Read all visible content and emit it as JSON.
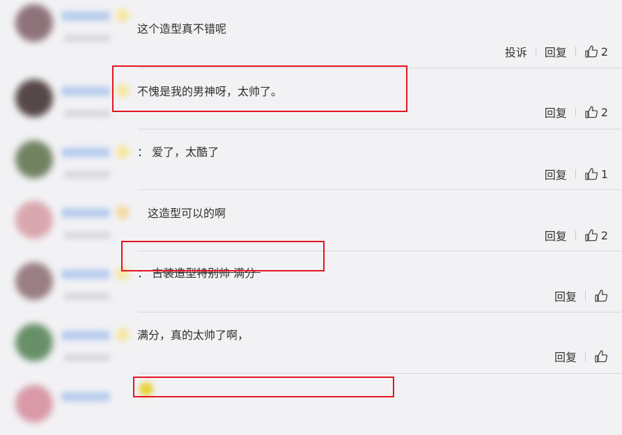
{
  "comments": [
    {
      "text": "这个造型真不错呢",
      "report_label": "投诉",
      "reply_label": "回复",
      "likes": "2",
      "avatar_color": "#7e5d65"
    },
    {
      "text": "不愧是我的男神呀，太帅了。",
      "reply_label": "回复",
      "likes": "2",
      "avatar_color": "#3b2a2b"
    },
    {
      "text": "：  爱了，太酷了",
      "reply_label": "回复",
      "likes": "1",
      "avatar_color": "#5b6f48"
    },
    {
      "text": "这造型可以的啊",
      "reply_label": "回复",
      "likes": "2",
      "avatar_color": "#d59aa2"
    },
    {
      "text": "：  古装造型特别帅 满分",
      "reply_label": "回复",
      "likes": "",
      "avatar_color": "#8a6a6e"
    },
    {
      "text": "满分，真的太帅了啊，",
      "reply_label": "回复",
      "likes": "",
      "avatar_color": "#4f7f50"
    }
  ],
  "colors": {
    "highlight": "#e3141e",
    "link": "#333333"
  }
}
